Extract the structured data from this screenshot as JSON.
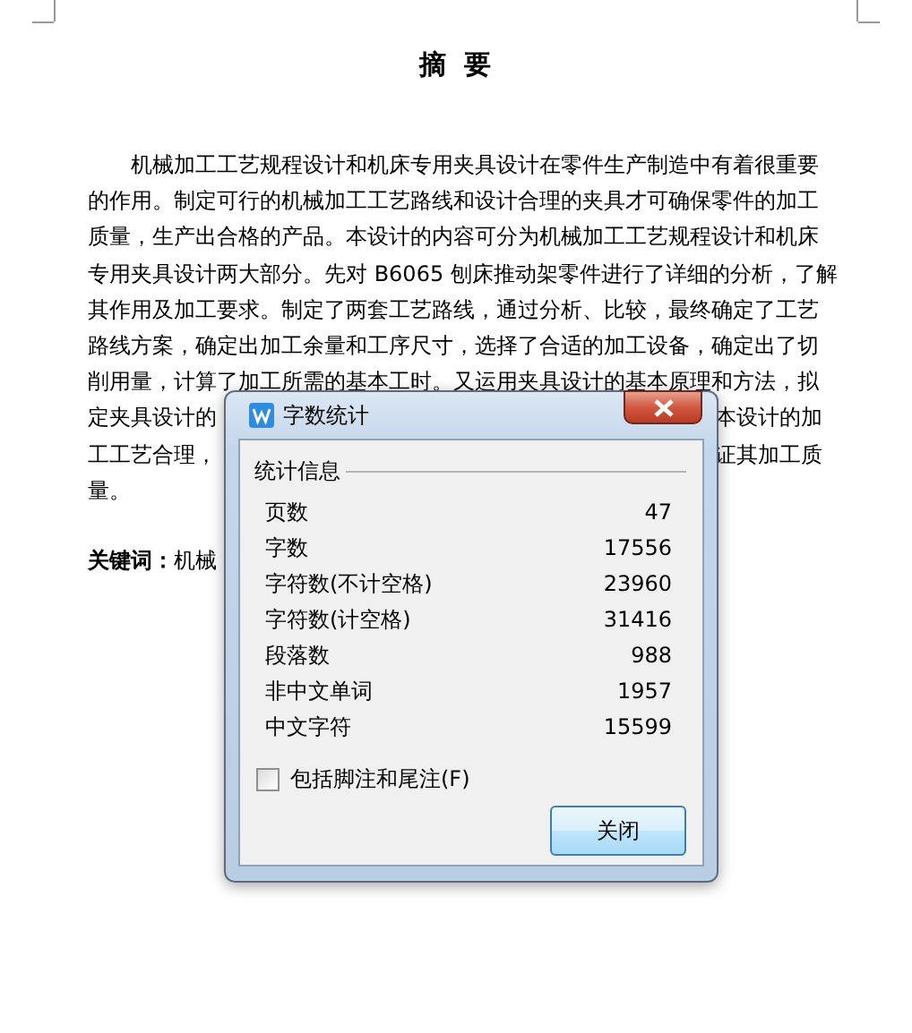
{
  "document": {
    "title": "摘  要",
    "lines": [
      [
        "机械加工工艺规程设计和机床专用夹具设计在零件生产制造中有着很重要"
      ],
      [
        "的作用。制定可行的机械加工工艺路线和设计合理的夹具才可确保零件的加工"
      ],
      [
        "质量，生产出合格的产品。本设计的内容可分为机械加工工艺规程设计和机床"
      ],
      [
        "专用夹具设计两大部分。先对 B6065 刨床推动架零件进行了详细的分析，了解"
      ],
      [
        "其作用及加工要求。制定了两套工艺路线，通过分析、比较，最终确定了工艺"
      ],
      [
        "路线方案，确定出加工余量和工序尺寸，选择了合适的加工设备，确定出了切"
      ],
      [
        "削用量，计算了加工所需的基本工时。又运用夹具设计的基本原理和方法，拟"
      ],
      [
        "定夹具设计的",
        "本设计的加"
      ],
      [
        "工工艺合理，",
        "证其加工质"
      ],
      [
        "量。"
      ]
    ],
    "keywords": "**关键词：**机械"
  },
  "dialog": {
    "title": "字数统计",
    "group": "统计信息",
    "stats": [
      {
        "label": "页数",
        "value": "47"
      },
      {
        "label": "字数",
        "value": "17556"
      },
      {
        "label": "字符数(不计空格)",
        "value": "23960"
      },
      {
        "label": "字符数(计空格)",
        "value": "31416"
      },
      {
        "label": "段落数",
        "value": "988"
      },
      {
        "label": "非中文单词",
        "value": "1957"
      },
      {
        "label": "中文字符",
        "value": "15599"
      }
    ],
    "checkbox": {
      "label": "包括脚注和尾注(F)",
      "checked": false
    },
    "button": "关闭"
  }
}
